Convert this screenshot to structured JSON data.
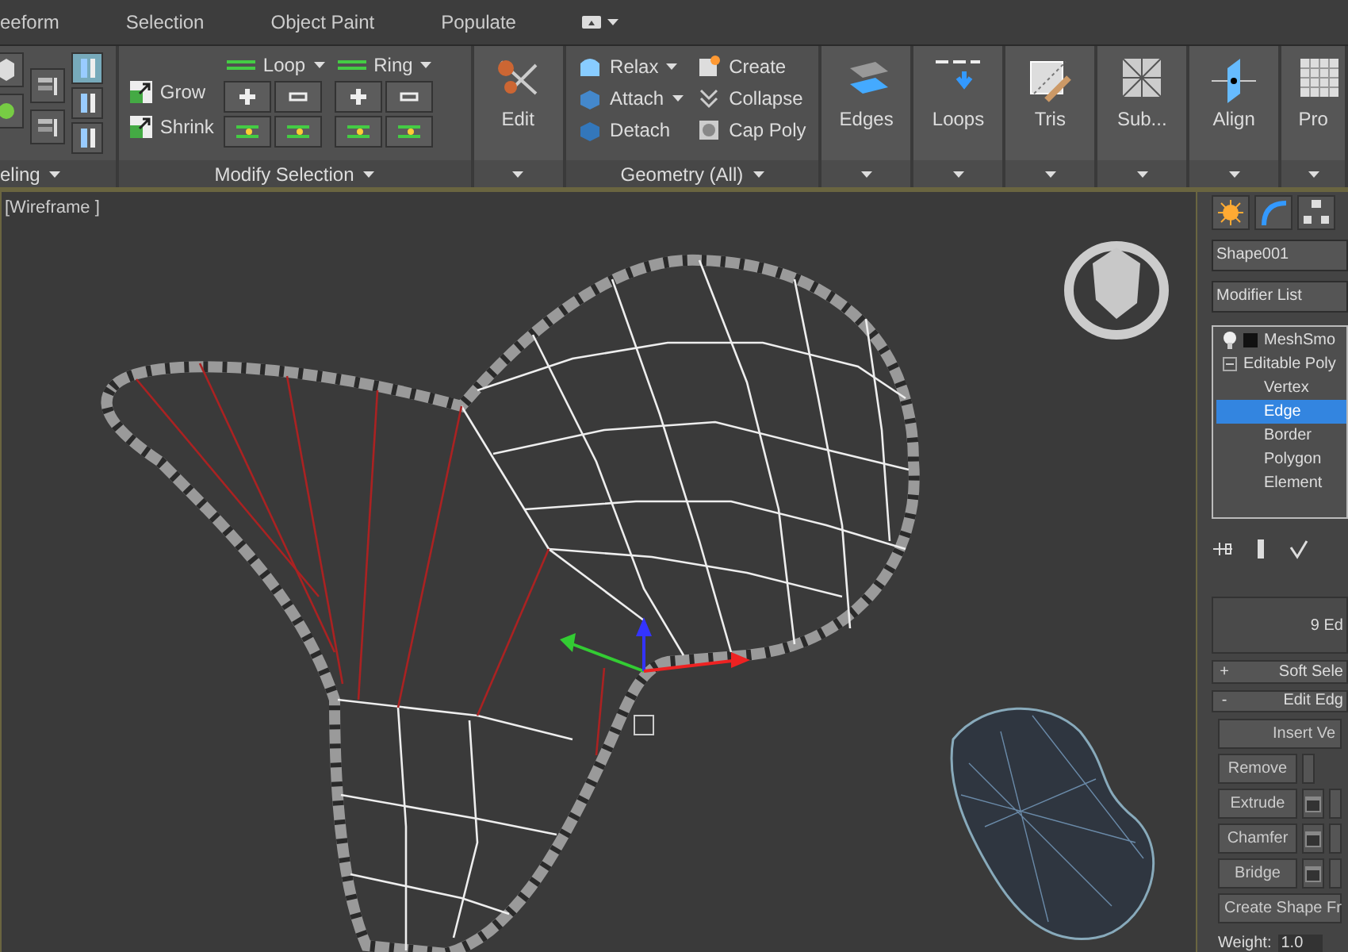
{
  "tabs": [
    {
      "label": "eeform"
    },
    {
      "label": "Selection"
    },
    {
      "label": "Object Paint"
    },
    {
      "label": "Populate"
    }
  ],
  "ribbon": {
    "partial_group": {
      "label": "eling"
    },
    "modify_selection": {
      "label": "Modify Selection",
      "grow": "Grow",
      "shrink": "Shrink",
      "loop": "Loop",
      "ring": "Ring"
    },
    "edit_button": {
      "label": "Edit"
    },
    "geometry": {
      "label": "Geometry (All)",
      "items": [
        {
          "label": "Relax",
          "dropdown": true
        },
        {
          "label": "Attach",
          "dropdown": true
        },
        {
          "label": "Detach",
          "dropdown": false
        },
        {
          "label": "Create",
          "dropdown": false
        },
        {
          "label": "Collapse",
          "dropdown": false
        },
        {
          "label": "Cap Poly",
          "dropdown": false
        }
      ]
    },
    "big_buttons": [
      {
        "label": "Edges"
      },
      {
        "label": "Loops"
      },
      {
        "label": "Tris"
      },
      {
        "label": "Sub..."
      },
      {
        "label": "Align"
      },
      {
        "label": "Pro"
      }
    ]
  },
  "viewport": {
    "label": "[Wireframe ]"
  },
  "command_panel": {
    "object_name": "Shape001",
    "modifier_list": "Modifier List",
    "stack": [
      {
        "label": "MeshSmo"
      },
      {
        "label": "Editable Poly",
        "children": [
          {
            "label": "Vertex",
            "selected": false
          },
          {
            "label": "Edge",
            "selected": true
          },
          {
            "label": "Border",
            "selected": false
          },
          {
            "label": "Polygon",
            "selected": false
          },
          {
            "label": "Element",
            "selected": false
          }
        ]
      }
    ],
    "selection_info": "9 Ed",
    "rollouts": [
      {
        "sign": "+",
        "label": "Soft Sele"
      },
      {
        "sign": "-",
        "label": "Edit Edg"
      }
    ],
    "insert_button": "Insert Ve",
    "edge_buttons": [
      {
        "label": "Remove",
        "settings": false
      },
      {
        "label": "Extrude",
        "settings": true
      },
      {
        "label": "Chamfer",
        "settings": true
      },
      {
        "label": "Bridge",
        "settings": true
      }
    ],
    "create_shape_button": "Create Shape Fr",
    "weight": {
      "label": "Weight:",
      "value": "1.0"
    }
  }
}
